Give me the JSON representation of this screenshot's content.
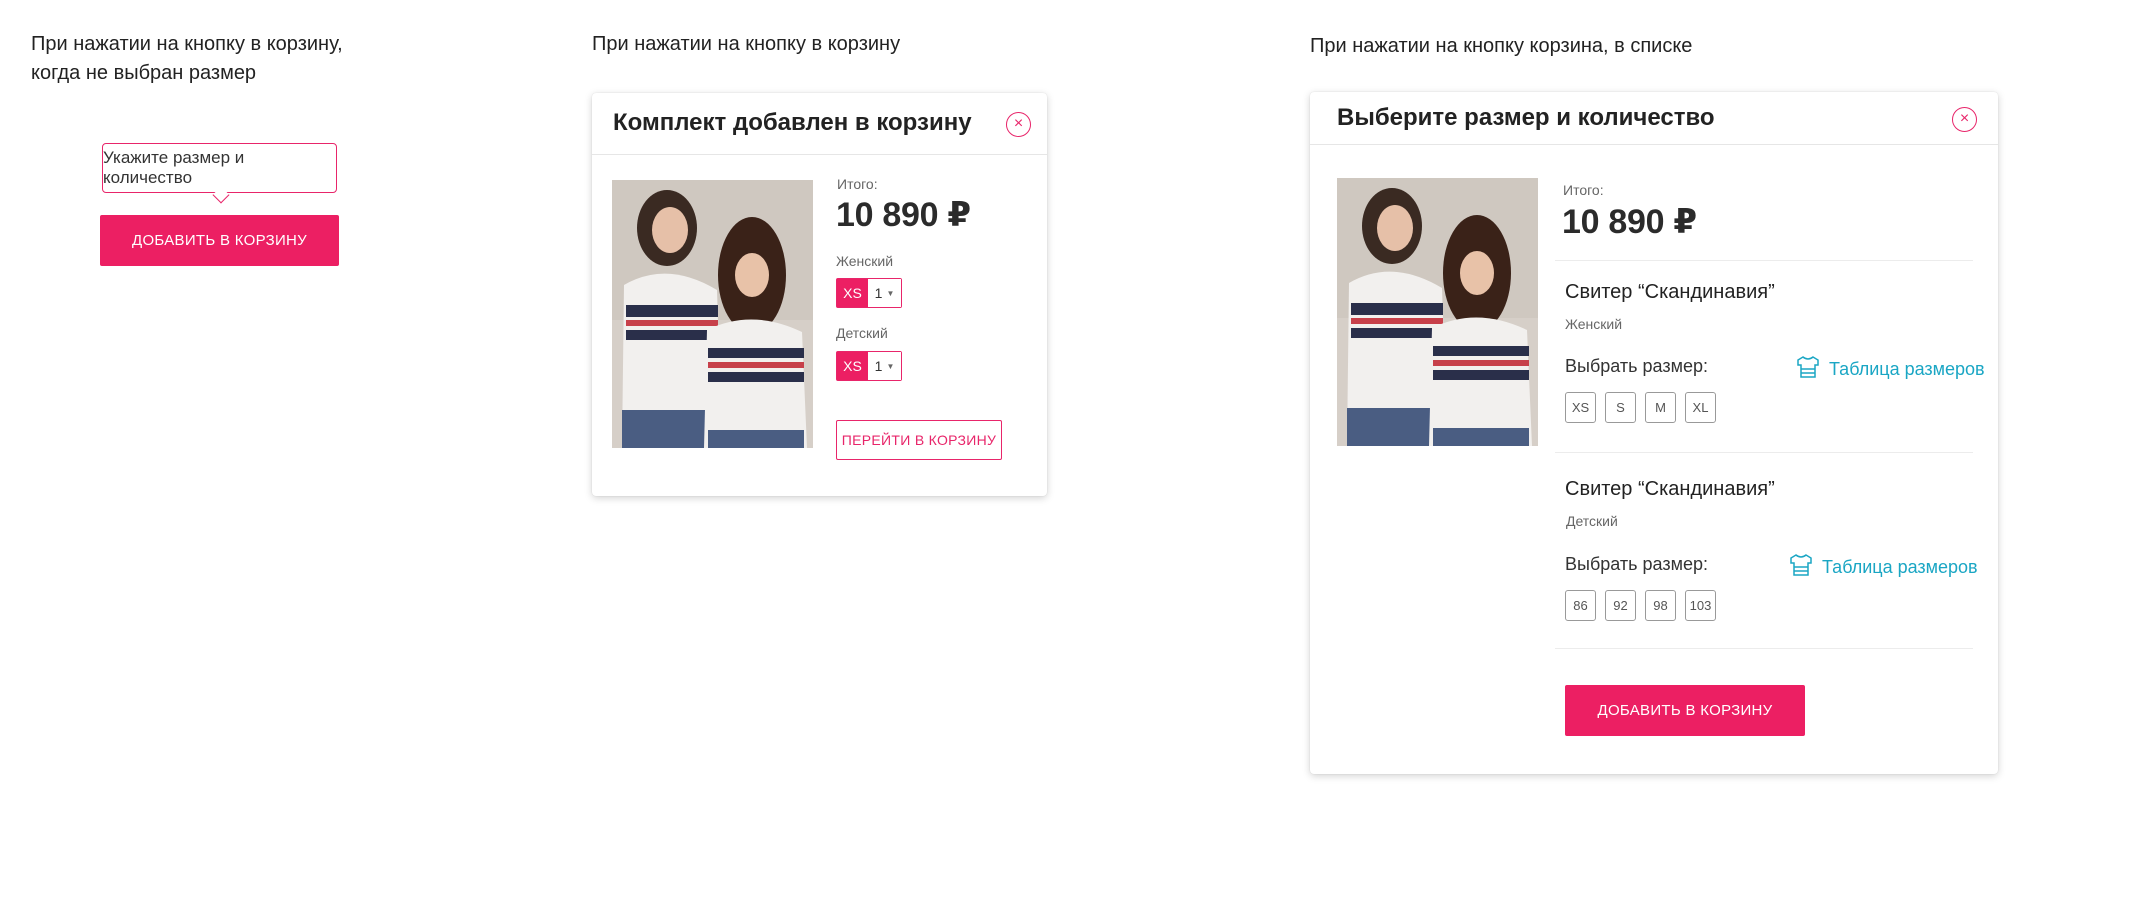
{
  "scenario1": {
    "caption": "При нажатии на кнопку в корзину,\nкогда не выбран размер",
    "tooltip": "Укажите размер и количество",
    "button": "ДОБАВИТЬ В КОРЗИНУ"
  },
  "scenario2": {
    "caption": "При нажатии на кнопку в корзину",
    "title": "Комплект добавлен в корзину",
    "close": "×",
    "total_label": "Итого:",
    "price": "10 890 ₽",
    "items": [
      {
        "label": "Женский",
        "size": "XS",
        "qty": "1"
      },
      {
        "label": "Детский",
        "size": "XS",
        "qty": "1"
      }
    ],
    "button": "ПЕРЕЙТИ В КОРЗИНУ"
  },
  "scenario3": {
    "caption": "При нажатии на кнопку корзина, в списке",
    "title": "Выберите размер и количество",
    "close": "×",
    "total_label": "Итого:",
    "price": "10 890 ₽",
    "products": [
      {
        "name": "Свитер “Скандинавия”",
        "variant": "Женский",
        "choose_label": "Выбрать размер:",
        "size_table": "Таблица размеров",
        "sizes": [
          "XS",
          "S",
          "M",
          "XL"
        ]
      },
      {
        "name": "Свитер “Скандинавия”",
        "variant": "Детский",
        "choose_label": "Выбрать размер:",
        "size_table": "Таблица размеров",
        "sizes": [
          "86",
          "92",
          "98",
          "103"
        ]
      }
    ],
    "button": "ДОБАВИТЬ В КОРЗИНУ"
  },
  "colors": {
    "accent": "#ec1f63",
    "link": "#1aa6c4"
  },
  "icons": [
    "close-icon",
    "size-table-icon",
    "caret-down-icon"
  ]
}
